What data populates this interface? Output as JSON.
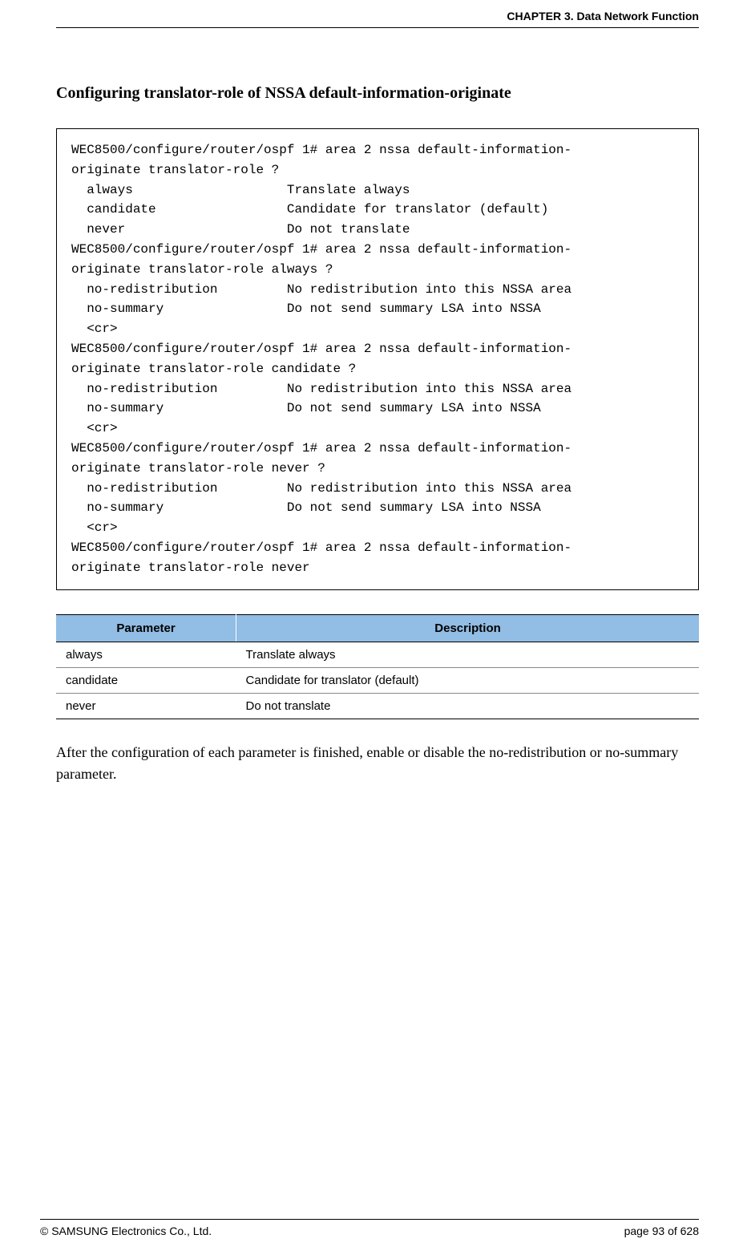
{
  "header": {
    "chapter": "CHAPTER 3. Data Network Function"
  },
  "section_title": "Configuring translator-role of NSSA default-information-originate",
  "code_block": "WEC8500/configure/router/ospf 1# area 2 nssa default-information-\noriginate translator-role ?\n  always                    Translate always\n  candidate                 Candidate for translator (default)\n  never                     Do not translate\nWEC8500/configure/router/ospf 1# area 2 nssa default-information-\noriginate translator-role always ?\n  no-redistribution         No redistribution into this NSSA area\n  no-summary                Do not send summary LSA into NSSA\n  <cr>\nWEC8500/configure/router/ospf 1# area 2 nssa default-information-\noriginate translator-role candidate ?\n  no-redistribution         No redistribution into this NSSA area\n  no-summary                Do not send summary LSA into NSSA\n  <cr>\nWEC8500/configure/router/ospf 1# area 2 nssa default-information-\noriginate translator-role never ?\n  no-redistribution         No redistribution into this NSSA area\n  no-summary                Do not send summary LSA into NSSA\n  <cr>\nWEC8500/configure/router/ospf 1# area 2 nssa default-information-\noriginate translator-role never",
  "table": {
    "headers": {
      "parameter": "Parameter",
      "description": "Description"
    },
    "rows": [
      {
        "parameter": "always",
        "description": "Translate always"
      },
      {
        "parameter": "candidate",
        "description": "Candidate for translator (default)"
      },
      {
        "parameter": "never",
        "description": "Do not translate"
      }
    ]
  },
  "body_text": "After the configuration of each parameter is finished, enable or disable the no-redistribution or no-summary parameter.",
  "footer": {
    "copyright": "© SAMSUNG Electronics Co., Ltd.",
    "page": "page 93 of 628"
  }
}
